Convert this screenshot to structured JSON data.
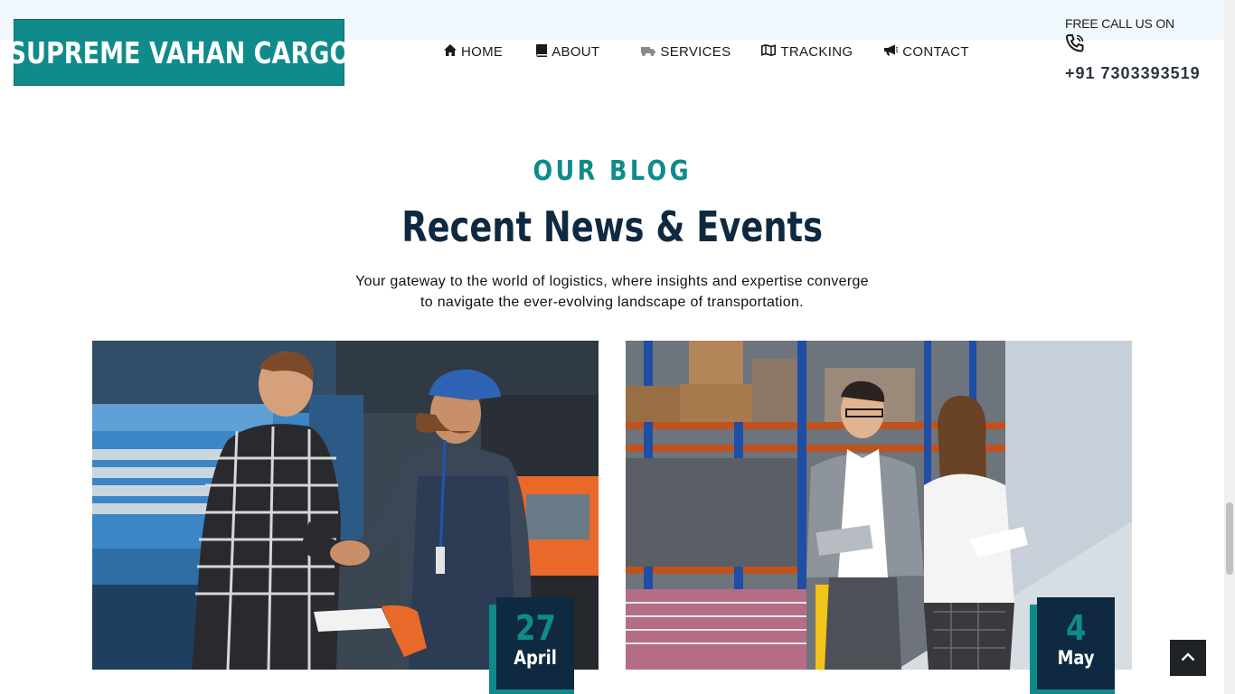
{
  "brand": {
    "name": "SUPREME VAHAN CARGO",
    "color": "#0e8b8a"
  },
  "nav": {
    "items": [
      {
        "label": "HOME",
        "icon": "home-icon"
      },
      {
        "label": "ABOUT",
        "icon": "book-icon"
      },
      {
        "label": "SERVICES",
        "icon": "truck-icon"
      },
      {
        "label": "TRACKING",
        "icon": "map-icon"
      },
      {
        "label": "CONTACT",
        "icon": "megaphone-icon"
      }
    ]
  },
  "call": {
    "label": "FREE CALL US ON",
    "icon": "phone-icon",
    "number": "+91 7303393519"
  },
  "blog": {
    "eyebrow": "OUR BLOG",
    "heading": "Recent News & Events",
    "subtext_line1": "Your gateway to the world of logistics, where insights and expertise converge",
    "subtext_line2": "to navigate the ever-evolving landscape of transportation.",
    "posts": [
      {
        "day": "27",
        "month": "April"
      },
      {
        "day": "4",
        "month": "May"
      }
    ]
  },
  "colors": {
    "navy": "#0f2a40",
    "teal": "#0e8b8a",
    "topbar": "#f0f7fd"
  },
  "scroll_top": {
    "icon": "chevron-up-icon"
  }
}
